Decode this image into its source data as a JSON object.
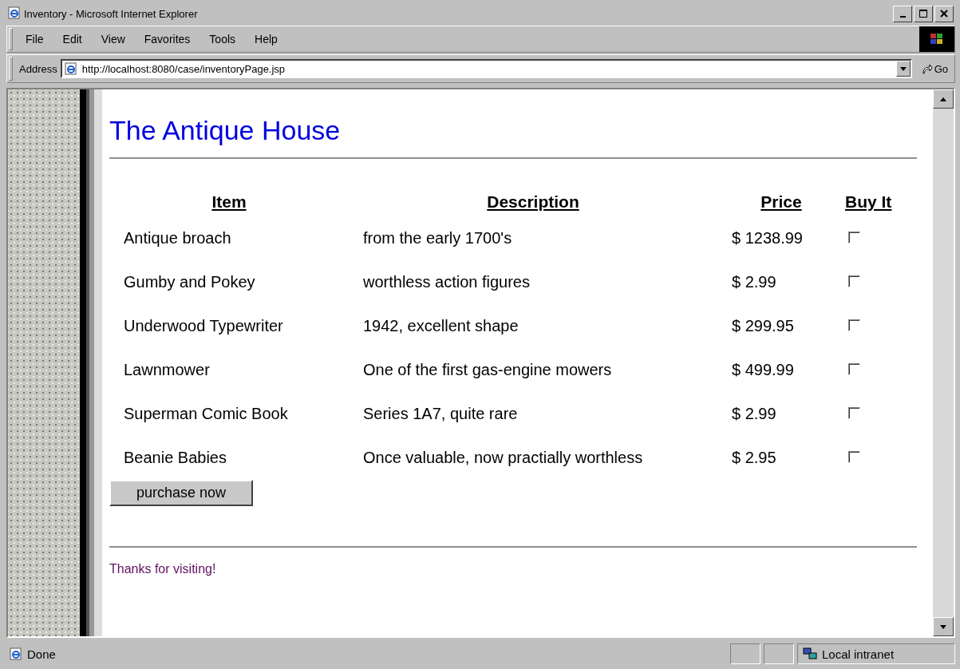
{
  "window": {
    "title": "Inventory - Microsoft Internet Explorer"
  },
  "menu": [
    "File",
    "Edit",
    "View",
    "Favorites",
    "Tools",
    "Help"
  ],
  "address": {
    "label": "Address",
    "value": "http://localhost:8080/case/inventoryPage.jsp",
    "go": "Go"
  },
  "page": {
    "heading": "The Antique House",
    "table": {
      "columns": [
        "Item",
        "Description",
        "Price",
        "Buy It"
      ],
      "rows": [
        {
          "item": "Antique broach",
          "description": "from the early 1700's",
          "price": "$ 1238.99",
          "checked": false
        },
        {
          "item": "Gumby and Pokey",
          "description": "worthless action figures",
          "price": "$ 2.99",
          "checked": false
        },
        {
          "item": "Underwood Typewriter",
          "description": "1942, excellent shape",
          "price": "$ 299.95",
          "checked": false
        },
        {
          "item": "Lawnmower",
          "description": "One of the first gas-engine mowers",
          "price": "$ 499.99",
          "checked": false
        },
        {
          "item": "Superman Comic Book",
          "description": "Series 1A7, quite rare",
          "price": "$ 2.99",
          "checked": false
        },
        {
          "item": "Beanie Babies",
          "description": "Once valuable, now practially worthless",
          "price": "$ 2.95",
          "checked": false
        }
      ]
    },
    "button": "purchase now",
    "footer": "Thanks for visiting!"
  },
  "status_bar": {
    "text": "Done",
    "zone": "Local intranet"
  }
}
